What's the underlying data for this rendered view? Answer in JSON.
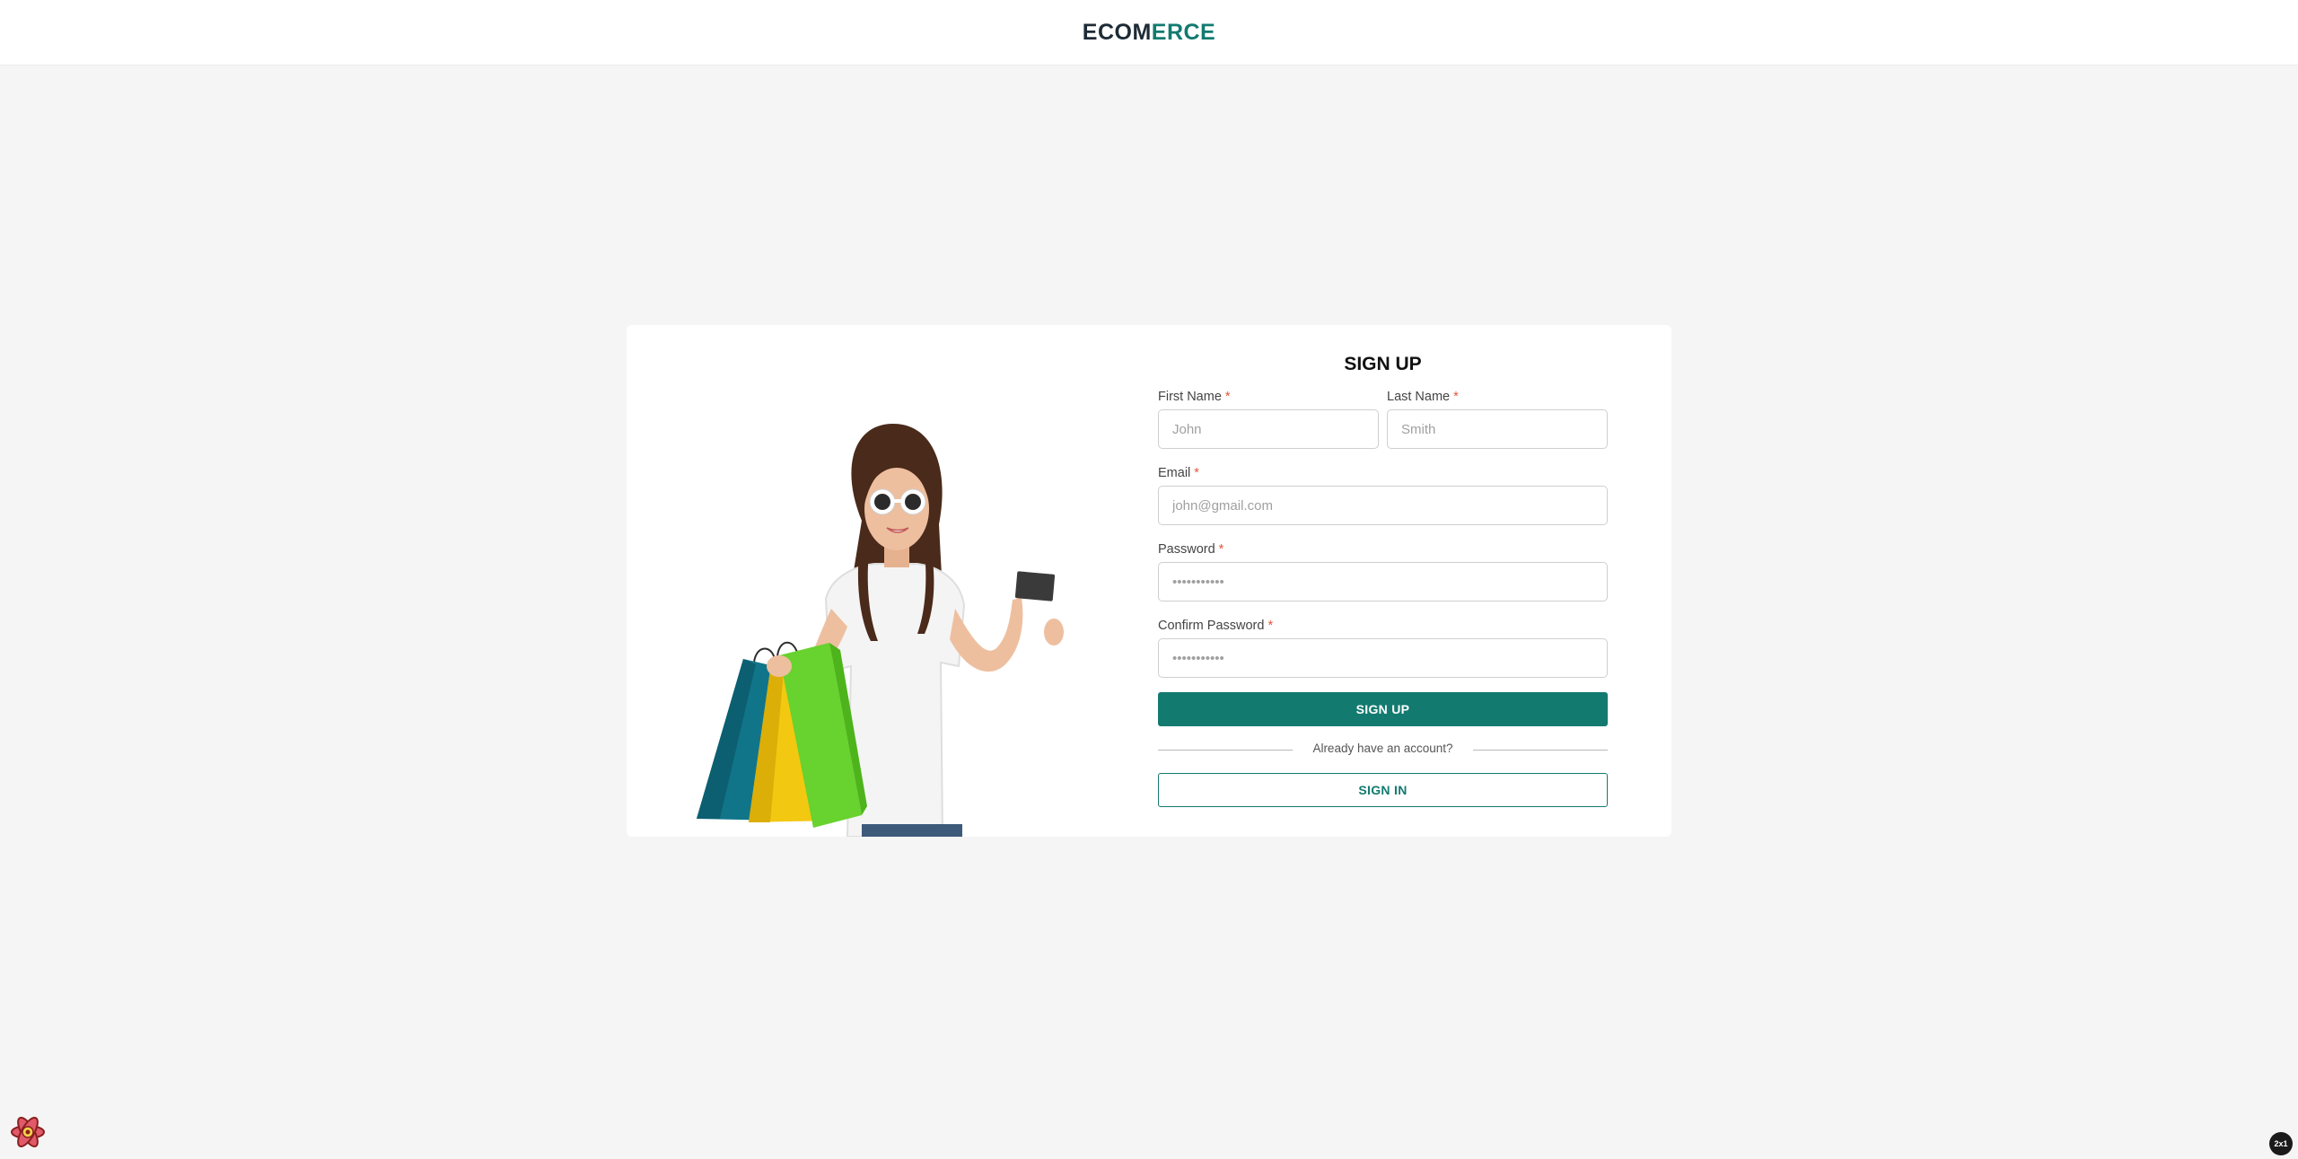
{
  "header": {
    "logo_part1": "ECOM",
    "logo_part2": "ERCE"
  },
  "form": {
    "title": "SIGN UP",
    "required_marker": "*",
    "first_name": {
      "label": "First Name",
      "placeholder": "John"
    },
    "last_name": {
      "label": "Last Name",
      "placeholder": "Smith"
    },
    "email": {
      "label": "Email",
      "placeholder": "john@gmail.com"
    },
    "password": {
      "label": "Password",
      "placeholder": "•••••••••••"
    },
    "confirm_password": {
      "label": "Confirm Password",
      "placeholder": "•••••••••••"
    },
    "signup_button": "SIGN UP",
    "divider_text": "Already have an account?",
    "signin_button": "SIGN IN"
  },
  "corner_badge": "2x1",
  "colors": {
    "accent": "#137a70",
    "logo_dark": "#1d2b36",
    "required": "#e2553b",
    "background": "#f5f5f5"
  }
}
